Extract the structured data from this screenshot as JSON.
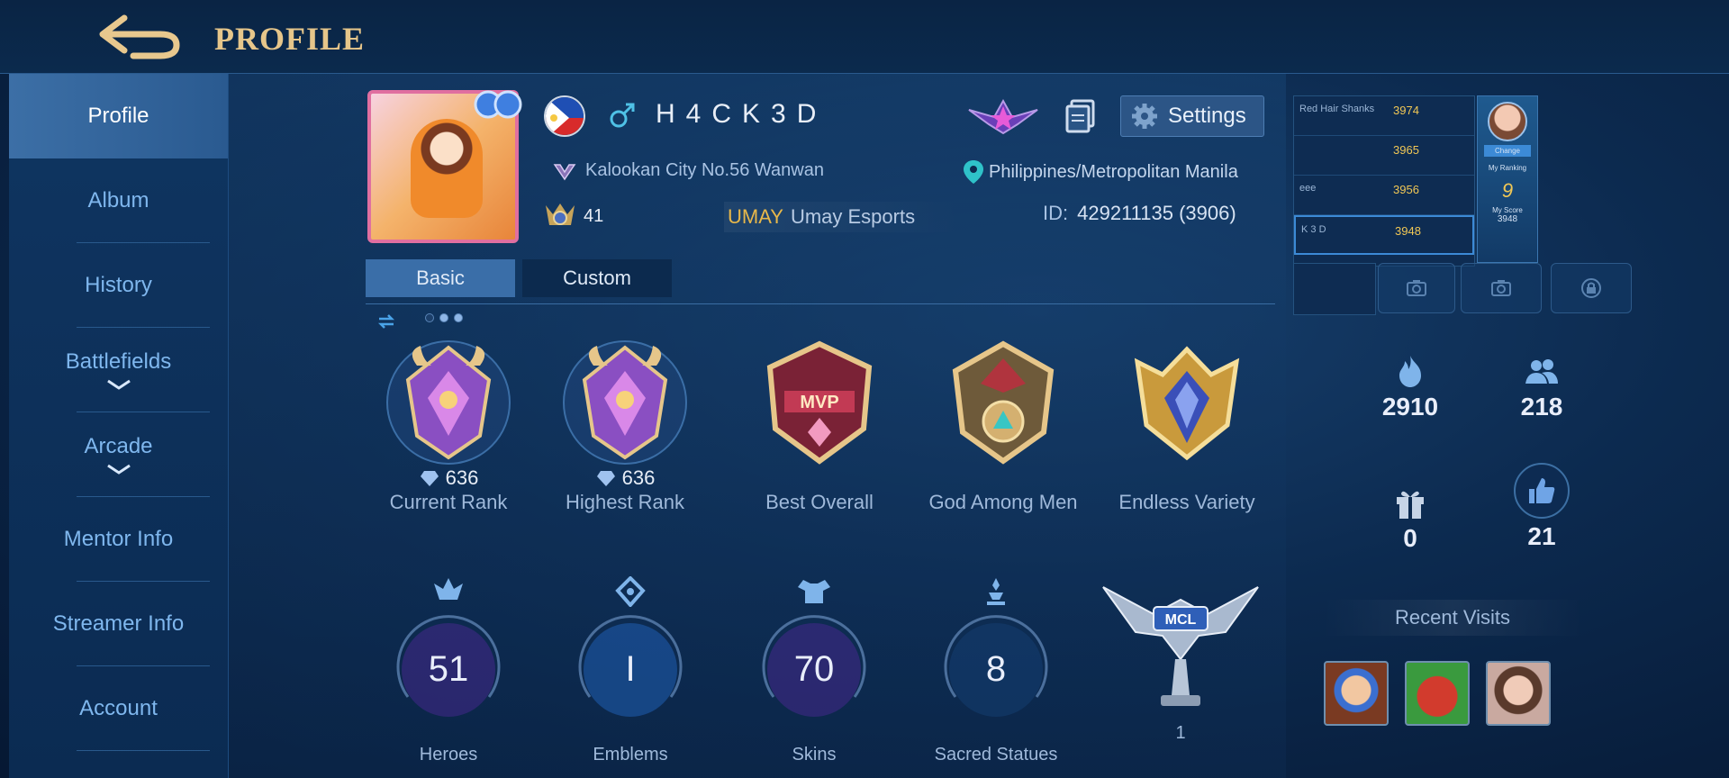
{
  "header": {
    "title": "PROFILE"
  },
  "sidebar": {
    "items": [
      {
        "label": "Profile"
      },
      {
        "label": "Album"
      },
      {
        "label": "History"
      },
      {
        "label": "Battlefields"
      },
      {
        "label": "Arcade"
      },
      {
        "label": "Mentor Info"
      },
      {
        "label": "Streamer Info"
      },
      {
        "label": "Account"
      }
    ]
  },
  "profile": {
    "username": "H4CK3D",
    "city": "Kalookan City No.56 Wanwan",
    "location": "Philippines/Metropolitan Manila",
    "level": "41",
    "squad_tag": "UMAY",
    "squad_name": "Umay Esports",
    "id_label": "ID:",
    "id_value": "429211135 (3906)",
    "settings_label": "Settings"
  },
  "tabs": [
    {
      "label": "Basic"
    },
    {
      "label": "Custom"
    }
  ],
  "medals": [
    {
      "points": "636",
      "label": "Current Rank"
    },
    {
      "points": "636",
      "label": "Highest Rank"
    },
    {
      "label": "Best Overall"
    },
    {
      "label": "God Among Men"
    },
    {
      "label": "Endless Variety"
    }
  ],
  "stats": [
    {
      "value": "51",
      "label": "Heroes"
    },
    {
      "value": "I",
      "label": "Emblems"
    },
    {
      "value": "70",
      "label": "Skins"
    },
    {
      "value": "8",
      "label": "Sacred Statues"
    }
  ],
  "mcl": {
    "count": "1"
  },
  "leaderboard": {
    "rows": [
      {
        "name": "Red Hair Shanks",
        "score": "3974"
      },
      {
        "name": "",
        "score": "3965"
      },
      {
        "name": "eee",
        "score": "3956"
      },
      {
        "name": "K 3 D",
        "score": "3948"
      }
    ],
    "change_label": "Change",
    "my_ranking_label": "My Ranking",
    "my_ranking": "9",
    "my_score_label": "My Score",
    "my_score": "3948"
  },
  "right_stats": {
    "popularity": "2910",
    "friends": "218",
    "gifts": "0",
    "likes": "21"
  },
  "recent": {
    "title": "Recent Visits"
  },
  "colors": {
    "accent_gold": "#e6c68a",
    "sidebar_active": "#3c6fa6",
    "score_gold": "#f0c755"
  }
}
